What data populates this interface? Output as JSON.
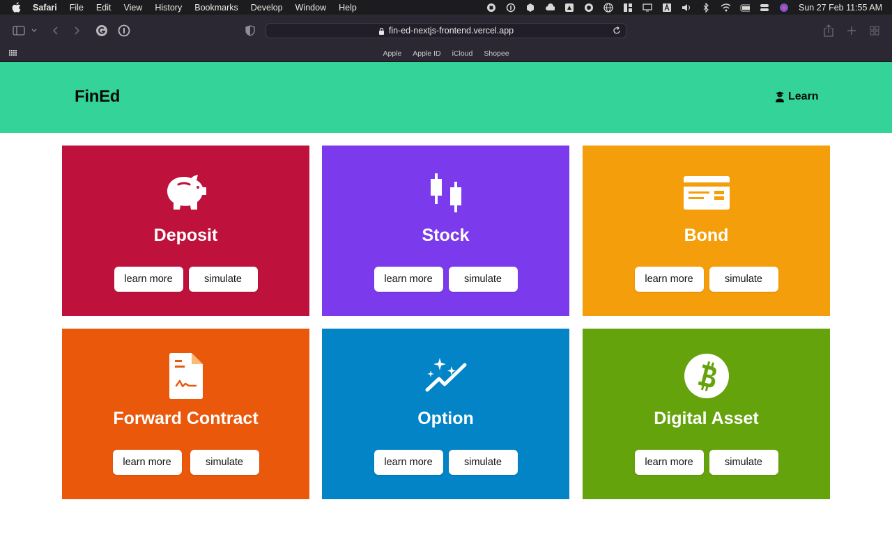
{
  "menubar": {
    "app_name": "Safari",
    "items": [
      "File",
      "Edit",
      "View",
      "History",
      "Bookmarks",
      "Develop",
      "Window",
      "Help"
    ],
    "clock": "Sun 27 Feb  11:55 AM"
  },
  "browser": {
    "url": "fin-ed-nextjs-frontend.vercel.app",
    "favorites": [
      "Apple",
      "Apple ID",
      "iCloud",
      "Shopee"
    ]
  },
  "site": {
    "logo": "FinEd",
    "nav_learn": "Learn",
    "header_color": "#34d399"
  },
  "cards": [
    {
      "title": "Deposit",
      "icon": "piggy-bank-icon",
      "color": "#be123c",
      "learn_label": "learn more",
      "simulate_label": "simulate"
    },
    {
      "title": "Stock",
      "icon": "candlestick-icon",
      "color": "#7c3aed",
      "learn_label": "learn more",
      "simulate_label": "simulate"
    },
    {
      "title": "Bond",
      "icon": "cheque-icon",
      "color": "#f59e0b",
      "learn_label": "learn more",
      "simulate_label": "simulate"
    },
    {
      "title": "Forward Contract",
      "icon": "contract-document-icon",
      "color": "#ea580c",
      "learn_label": "learn more",
      "simulate_label": "simulate"
    },
    {
      "title": "Option",
      "icon": "sparkle-trend-icon",
      "color": "#0284c7",
      "learn_label": "learn more",
      "simulate_label": "simulate"
    },
    {
      "title": "Digital Asset",
      "icon": "bitcoin-icon",
      "color": "#65a30d",
      "learn_label": "learn more",
      "simulate_label": "simulate"
    }
  ]
}
